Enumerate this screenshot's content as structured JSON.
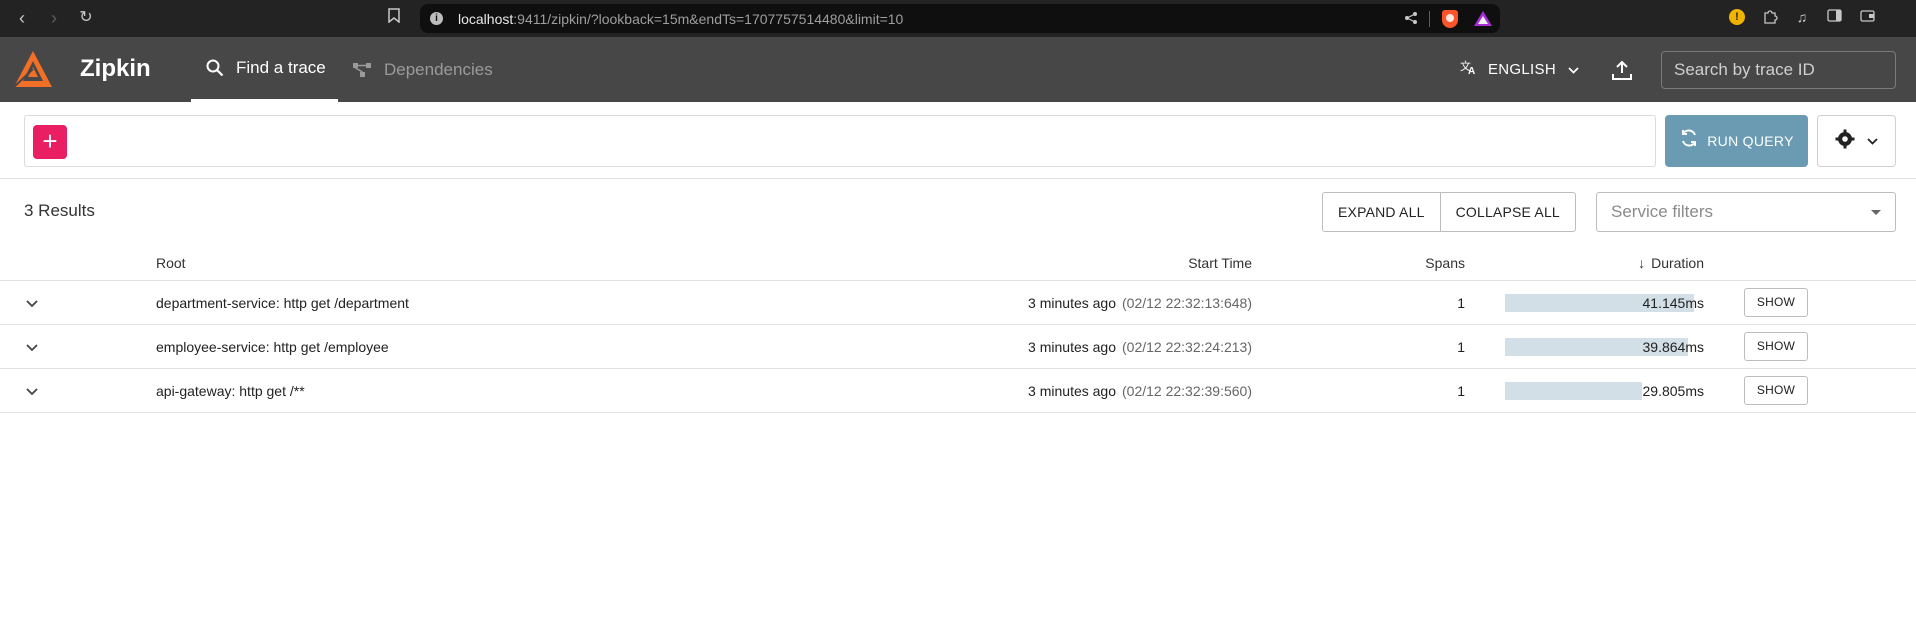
{
  "browser": {
    "url_host": "localhost",
    "url_rest": ":9411/zipkin/?lookback=15m&endTs=1707757514480&limit=10"
  },
  "header": {
    "app_title": "Zipkin",
    "tabs": [
      {
        "label": "Find a trace",
        "active": true
      },
      {
        "label": "Dependencies",
        "active": false
      }
    ],
    "language": "ENGLISH",
    "trace_search_placeholder": "Search by trace ID"
  },
  "query": {
    "add_label": "+",
    "run_label": "RUN QUERY"
  },
  "results": {
    "count_label": "3 Results",
    "expand_all": "EXPAND ALL",
    "collapse_all": "COLLAPSE ALL",
    "service_filter_placeholder": "Service filters"
  },
  "table": {
    "headers": {
      "root": "Root",
      "start_time": "Start Time",
      "spans": "Spans",
      "duration": "Duration"
    },
    "sort_indicator": "↓",
    "rows": [
      {
        "root": "department-service: http get /department",
        "relative": "3 minutes ago",
        "absolute": "(02/12 22:32:13:648)",
        "spans": "1",
        "duration": "41.145ms",
        "duration_fraction": 0.95,
        "show": "SHOW"
      },
      {
        "root": "employee-service: http get /employee",
        "relative": "3 minutes ago",
        "absolute": "(02/12 22:32:24:213)",
        "spans": "1",
        "duration": "39.864ms",
        "duration_fraction": 0.92,
        "show": "SHOW"
      },
      {
        "root": "api-gateway: http get /**",
        "relative": "3 minutes ago",
        "absolute": "(02/12 22:32:39:560)",
        "spans": "1",
        "duration": "29.805ms",
        "duration_fraction": 0.69,
        "show": "SHOW"
      }
    ]
  },
  "colors": {
    "header_bg": "#474747",
    "accent_pink": "#e91e63",
    "run_button": "#6a9bb3",
    "duration_bar": "#d3dfe6",
    "logo_orange": "#f26f27"
  },
  "icons": {
    "back": "arrow-left-icon",
    "forward": "arrow-right-icon",
    "reload": "reload-icon",
    "find": "search-icon",
    "deps": "dependencies-icon",
    "translate": "translate-icon",
    "upload": "upload-icon",
    "refresh": "refresh-icon",
    "settings": "gear-icon",
    "expand": "chevron-down-icon"
  }
}
